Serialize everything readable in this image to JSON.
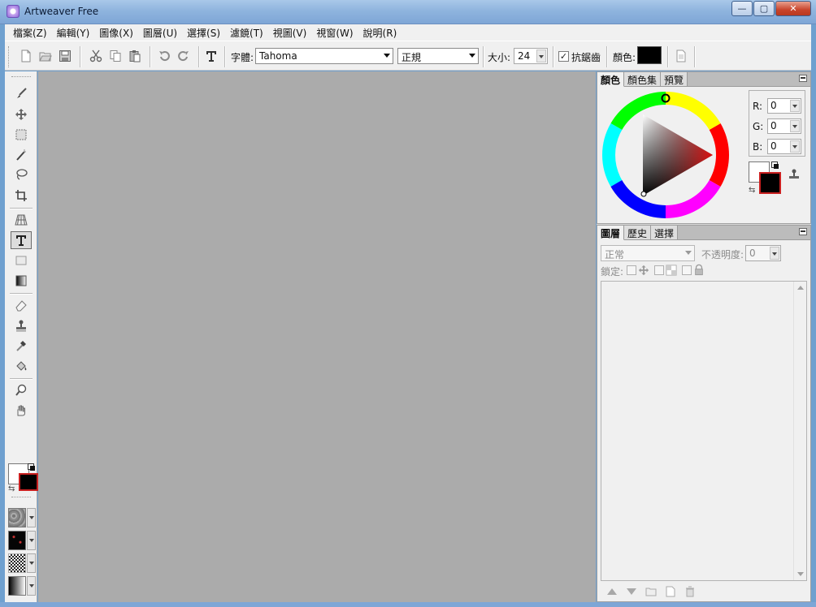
{
  "window": {
    "title": "Artweaver Free"
  },
  "window_controls": {
    "minimize": "—",
    "maximize": "▢",
    "close": "✕"
  },
  "menu": [
    "檔案(Z)",
    "編輯(Y)",
    "圖像(X)",
    "圖層(U)",
    "選擇(S)",
    "濾鏡(T)",
    "視圖(V)",
    "視窗(W)",
    "說明(R)"
  ],
  "toolbar": {
    "font_label": "字體:",
    "font_value": "Tahoma",
    "style_value": "正規",
    "size_label": "大小:",
    "size_value": "24",
    "antialias_label": "抗鋸齒",
    "antialias_checked": "✓",
    "color_label": "顏色:",
    "color_value": "#000000"
  },
  "color_panel": {
    "tabs": [
      "顏色",
      "顏色集",
      "預覽"
    ],
    "r_label": "R:",
    "r_value": "0",
    "g_label": "G:",
    "g_value": "0",
    "b_label": "B:",
    "b_value": "0",
    "foreground": "#000000",
    "background": "#ffffff"
  },
  "layers_panel": {
    "tabs": [
      "圖層",
      "歷史",
      "選擇"
    ],
    "blend_mode": "正常",
    "opacity_label": "不透明度:",
    "opacity_value": "0",
    "lock_label": "鎖定:"
  },
  "tool_colors": {
    "foreground": "#000000",
    "background": "#ffffff"
  },
  "colors": {
    "canvas": "#ababab",
    "panel": "#f0f0f0",
    "accent_red": "#c92020"
  }
}
